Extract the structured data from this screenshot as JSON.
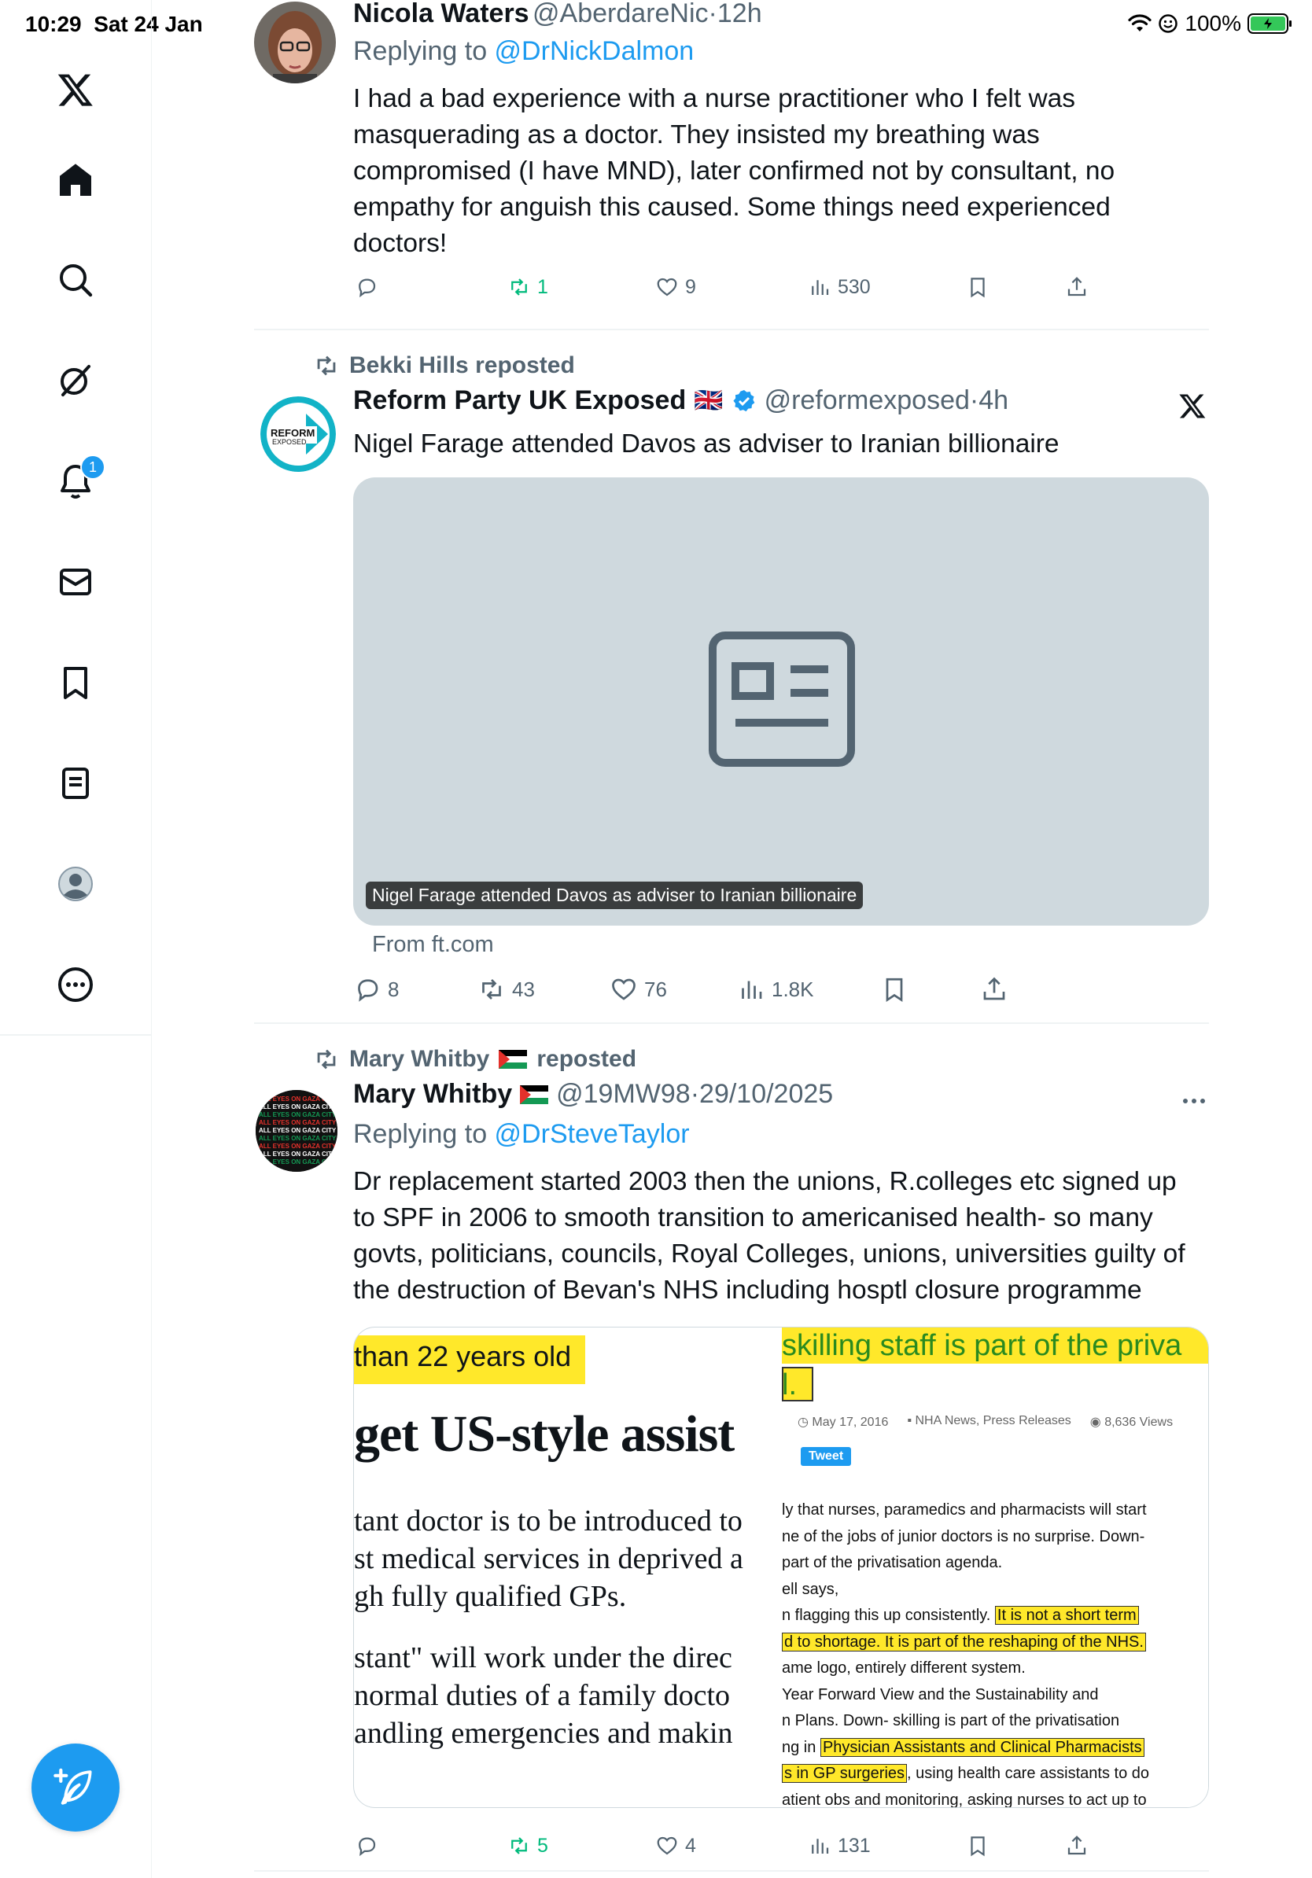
{
  "status": {
    "time": "10:29",
    "date": "Sat 24 Jan",
    "battery": "100%"
  },
  "sidebar": {
    "items": [
      {
        "name": "x-logo"
      },
      {
        "name": "home"
      },
      {
        "name": "search"
      },
      {
        "name": "grok"
      },
      {
        "name": "notifications",
        "badge": "1"
      },
      {
        "name": "messages"
      },
      {
        "name": "bookmarks"
      },
      {
        "name": "lists"
      },
      {
        "name": "profile"
      },
      {
        "name": "more"
      }
    ],
    "compose_icon": "compose-feather-icon"
  },
  "tweets": [
    {
      "name": "Nicola Waters",
      "handle": "@AberdareNic",
      "sep": "·",
      "time": "12h",
      "replying_prefix": "Replying to ",
      "replying_to": "@DrNickDalmon",
      "text": "I had a bad experience with a nurse practitioner who I felt was masquerading as a doctor. They insisted my breathing was compromised (I have MND), later confirmed not by consultant, no empathy for anguish this caused. Some things need experienced doctors!",
      "replies": "",
      "reposts": "1",
      "likes": "9",
      "views": "530"
    },
    {
      "repost_by": "Bekki Hills reposted",
      "name": "Reform Party UK Exposed",
      "flag": "🇬🇧",
      "handle": "@reformexposed",
      "sep": "·",
      "time": "4h",
      "avatar_text_top": "REFORM",
      "avatar_text_bottom": "EXPOSED",
      "text": "Nigel Farage attended Davos as adviser to Iranian billionaire",
      "card_caption": "Nigel Farage attended Davos as adviser to Iranian billionaire",
      "card_source": "From ft.com",
      "replies": "8",
      "reposts": "43",
      "likes": "76",
      "views": "1.8K"
    },
    {
      "repost_by": "Mary Whitby",
      "repost_suffix": "reposted",
      "name": "Mary Whitby",
      "handle": "@19MW98",
      "sep": "·",
      "time": "29/10/2025",
      "replying_prefix": "Replying to ",
      "replying_to": "@DrSteveTaylor",
      "text": "Dr replacement started 2003 then the unions, R.colleges etc signed up to SPF in 2006 to smooth transition to americanised health- so many govts, politicians, councils, Royal Colleges, unions, universities guilty of the destruction of Bevan's NHS including hosptl closure programme",
      "avatar_text": "ALL EYES ON GAZA CITY",
      "image_left": {
        "highlight": "than 22 years old",
        "headline": "get US-style assist",
        "para1": [
          "tant doctor is to be introduced to",
          "st medical services in deprived a",
          "gh fully qualified GPs."
        ],
        "para2": [
          "stant\" will work under the direc",
          "normal duties of a family docto",
          "andling emergencies and makin"
        ]
      },
      "image_right": {
        "headline": "skilling staff is part of the priva",
        "headline2": "l.",
        "meta_date": "May 17, 2016",
        "meta_cat": "NHA News, Press Releases",
        "meta_views": "8,636 Views",
        "tweet_btn": "Tweet",
        "lines": [
          {
            "t": "ly that nurses, paramedics and pharmacists will start"
          },
          {
            "t": "ne of the jobs of junior doctors is no surprise. Down-"
          },
          {
            "t": "part of the privatisation agenda."
          },
          {
            "t": "ell says,"
          },
          {
            "t": "n flagging this up consistently. ",
            "h": "It is not a short term"
          },
          {
            "t": "",
            "h": "d to shortage. It is part of the reshaping of the NHS."
          },
          {
            "t": "ame logo, entirely different system."
          },
          {
            "t": " Year Forward View and the Sustainability and"
          },
          {
            "t": "n Plans.  Down- skilling is part of the privatisation"
          },
          {
            "t": "ng in ",
            "h": "Physician Assistants and Clinical Pharmacists"
          },
          {
            "t": ", using health care assistants to do",
            "hpre": "s in GP surgeries"
          },
          {
            "t": "atient obs and monitoring, asking nurses to act up to"
          }
        ]
      },
      "replies": "",
      "reposts": "5",
      "likes": "4",
      "views": "131"
    }
  ],
  "colors": {
    "accent": "#1d9bf0",
    "repost_green": "#00ba7c",
    "muted": "#536471"
  }
}
